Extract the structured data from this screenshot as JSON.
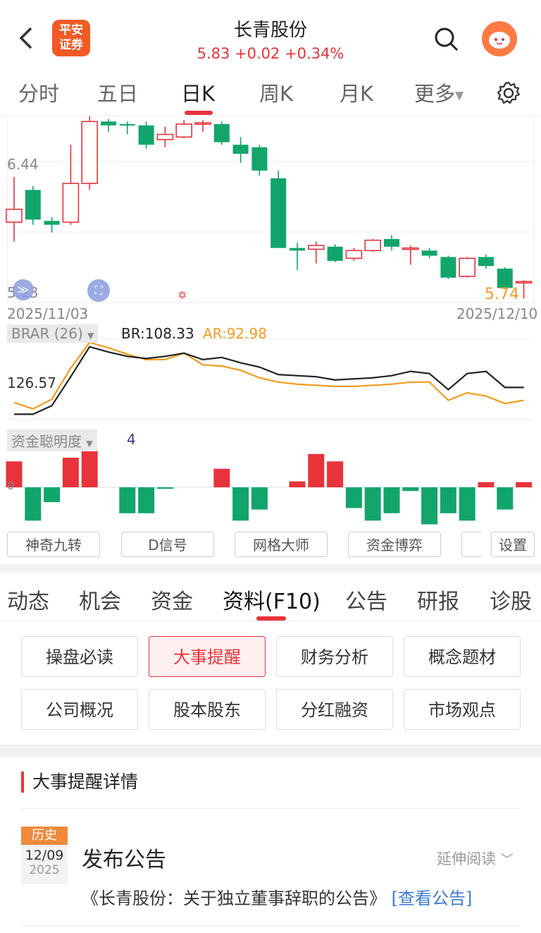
{
  "header": {
    "back_icon": "chevron-left-icon",
    "logo_line1": "平安",
    "logo_line2": "证券",
    "title": "长青股份",
    "price_change": "5.83 +0.02 +0.34%",
    "price_color": "#e8333b"
  },
  "period_tabs": [
    "分时",
    "五日",
    "日K",
    "周K",
    "月K",
    "更多"
  ],
  "active_period": "日K",
  "chart": {
    "price_labels": [
      "6.44",
      "5.23"
    ],
    "last_price": "5.74",
    "start_date": "2025/11/03",
    "end_date": "2025/12/10",
    "brar": {
      "label": "BRAR (26)",
      "br": "BR:108.33",
      "ar": "AR:92.98",
      "axis_label": "126.57"
    },
    "fund": {
      "label": "资金聪明度",
      "value": "4",
      "axis_label": "0"
    },
    "colors": {
      "up": "#e8333b",
      "down": "#12a56b",
      "br": "#222222",
      "ar": "#f39c1f"
    }
  },
  "chart_data": {
    "type": "candlestick",
    "candles": [
      {
        "o": 6.2,
        "c": 6.3,
        "h": 6.55,
        "l": 6.05,
        "dir": "up"
      },
      {
        "o": 6.45,
        "c": 6.22,
        "h": 6.48,
        "l": 6.18,
        "dir": "down"
      },
      {
        "o": 6.21,
        "c": 6.18,
        "h": 6.24,
        "l": 6.12,
        "dir": "down"
      },
      {
        "o": 6.2,
        "c": 6.5,
        "h": 6.8,
        "l": 6.18,
        "dir": "up"
      },
      {
        "o": 6.5,
        "c": 6.98,
        "h": 7.02,
        "l": 6.45,
        "dir": "up"
      },
      {
        "o": 6.98,
        "c": 6.95,
        "h": 7.0,
        "l": 6.9,
        "dir": "down"
      },
      {
        "o": 6.96,
        "c": 6.95,
        "h": 6.98,
        "l": 6.88,
        "dir": "down"
      },
      {
        "o": 6.95,
        "c": 6.8,
        "h": 6.98,
        "l": 6.77,
        "dir": "down"
      },
      {
        "o": 6.84,
        "c": 6.88,
        "h": 6.94,
        "l": 6.78,
        "dir": "up"
      },
      {
        "o": 6.86,
        "c": 6.96,
        "h": 6.99,
        "l": 6.85,
        "dir": "up"
      },
      {
        "o": 6.96,
        "c": 6.97,
        "h": 6.99,
        "l": 6.9,
        "dir": "up"
      },
      {
        "o": 6.96,
        "c": 6.82,
        "h": 6.98,
        "l": 6.8,
        "dir": "down"
      },
      {
        "o": 6.8,
        "c": 6.73,
        "h": 6.86,
        "l": 6.66,
        "dir": "down"
      },
      {
        "o": 6.78,
        "c": 6.6,
        "h": 6.8,
        "l": 6.56,
        "dir": "down"
      },
      {
        "o": 6.54,
        "c": 6.0,
        "h": 6.6,
        "l": 6.0,
        "dir": "down"
      },
      {
        "o": 6.0,
        "c": 5.98,
        "h": 6.04,
        "l": 5.83,
        "dir": "down"
      },
      {
        "o": 5.99,
        "c": 6.02,
        "h": 6.05,
        "l": 5.88,
        "dir": "up"
      },
      {
        "o": 6.01,
        "c": 5.9,
        "h": 6.03,
        "l": 5.89,
        "dir": "down"
      },
      {
        "o": 5.92,
        "c": 5.98,
        "h": 6.0,
        "l": 5.9,
        "dir": "up"
      },
      {
        "o": 5.98,
        "c": 6.06,
        "h": 6.07,
        "l": 5.97,
        "dir": "up"
      },
      {
        "o": 6.07,
        "c": 6.01,
        "h": 6.1,
        "l": 5.98,
        "dir": "down"
      },
      {
        "o": 5.99,
        "c": 6.0,
        "h": 6.02,
        "l": 5.87,
        "dir": "up"
      },
      {
        "o": 5.98,
        "c": 5.94,
        "h": 6.0,
        "l": 5.92,
        "dir": "down"
      },
      {
        "o": 5.93,
        "c": 5.77,
        "h": 5.94,
        "l": 5.76,
        "dir": "down"
      },
      {
        "o": 5.78,
        "c": 5.92,
        "h": 5.93,
        "l": 5.77,
        "dir": "up"
      },
      {
        "o": 5.93,
        "c": 5.86,
        "h": 5.95,
        "l": 5.84,
        "dir": "down"
      },
      {
        "o": 5.84,
        "c": 5.69,
        "h": 5.85,
        "l": 5.68,
        "dir": "down"
      },
      {
        "o": 5.73,
        "c": 5.74,
        "h": 5.75,
        "l": 5.61,
        "dir": "up"
      }
    ],
    "br": [
      80,
      80,
      88,
      115,
      143,
      138,
      134,
      132,
      134,
      137,
      131,
      133,
      128,
      124,
      117,
      116,
      115,
      112,
      113,
      114,
      116,
      120,
      118,
      103,
      118,
      120,
      105,
      105
    ],
    "ar": [
      91,
      85,
      94,
      123,
      147,
      142,
      136,
      131,
      131,
      137,
      126,
      125,
      121,
      114,
      110,
      108,
      107,
      106,
      106,
      107,
      108,
      110,
      110,
      93,
      100,
      97,
      90,
      93
    ],
    "fund_values": [
      3.5,
      -4.5,
      -2,
      4,
      5,
      0,
      -3.5,
      -3.5,
      -0.2,
      0,
      0,
      2.5,
      -4.5,
      -3,
      0,
      0.8,
      4.5,
      3.5,
      -2.8,
      -4.5,
      -3.5,
      -0.5,
      -5,
      -3.5,
      -4.5,
      0.7,
      -3,
      0.7
    ]
  },
  "indicator_buttons": [
    "神奇九转",
    "D信号",
    "网格大师",
    "资金博弈",
    "",
    "设置"
  ],
  "section_tabs": [
    "动态",
    "机会",
    "资金",
    "资料(F10)",
    "公告",
    "研报",
    "诊股"
  ],
  "active_section": "资料(F10)",
  "f10_buttons": [
    "操盘必读",
    "大事提醒",
    "财务分析",
    "概念题材",
    "公司概况",
    "股本股东",
    "分红融资",
    "市场观点"
  ],
  "active_f10": "大事提醒",
  "detail": {
    "title": "大事提醒详情",
    "tag": "历史",
    "date": "12/09",
    "year": "2025",
    "event_title": "发布公告",
    "extend_label": "延伸阅读",
    "event_text": "《长青股份：关于独立董事辞职的公告》",
    "link_label": "[查看公告]"
  }
}
